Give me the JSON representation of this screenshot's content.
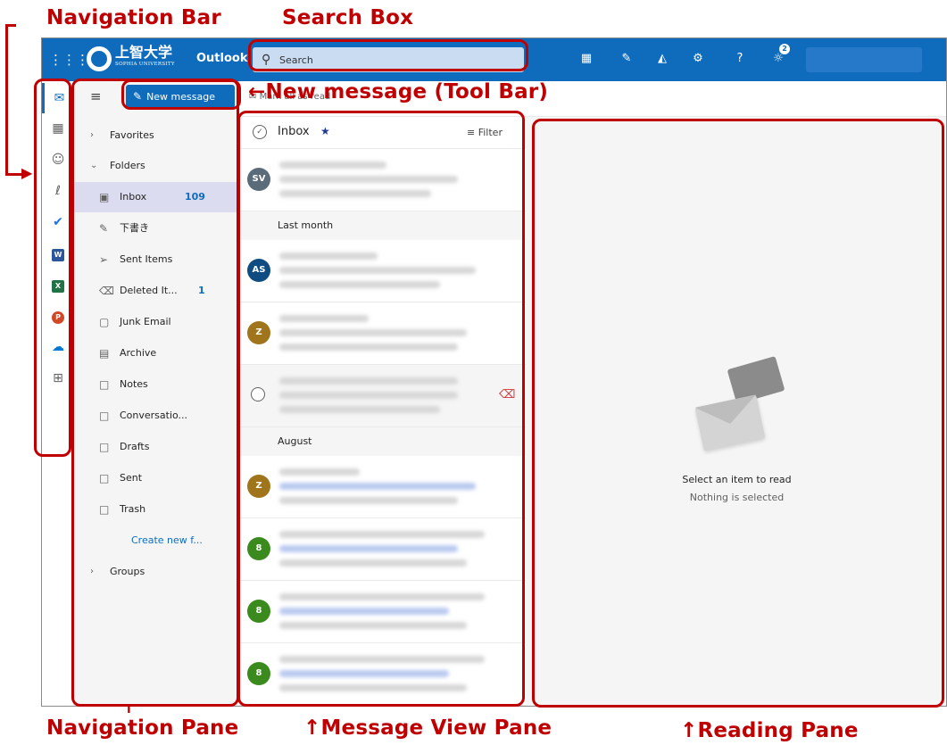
{
  "annotations": {
    "navigation_bar": "Navigation Bar",
    "search_box": "Search Box",
    "new_message_toolbar": "←New message (Tool Bar)",
    "navigation_pane": "Navigation Pane",
    "message_view_pane": "↑Message View Pane",
    "reading_pane": "↑Reading Pane",
    "up_arrow": "↑",
    "color": "#c00000"
  },
  "header": {
    "logo_jp": "上智大学",
    "logo_en": "SOPHIA UNIVERSITY",
    "app_name": "Outlook",
    "search_placeholder": "Search",
    "notification_badge": "2",
    "accent": "#0f6cbd",
    "icons": [
      "waffle-icon",
      "teams-icon",
      "feedback-icon",
      "bell-icon",
      "gear-icon",
      "help-icon",
      "lightbulb-icon"
    ]
  },
  "rail": {
    "items": [
      "mail-icon",
      "calendar-icon",
      "people-icon",
      "attachment-icon",
      "todo-icon",
      "word-icon",
      "excel-icon",
      "powerpoint-icon",
      "onedrive-icon",
      "more-apps-icon"
    ]
  },
  "nav": {
    "new_message": "New message",
    "favorites": "Favorites",
    "folders": "Folders",
    "items": [
      {
        "label": "Inbox",
        "count": "109"
      },
      {
        "label": "下書き",
        "count": ""
      },
      {
        "label": "Sent Items",
        "count": ""
      },
      {
        "label": "Deleted It...",
        "count": "1"
      },
      {
        "label": "Junk Email",
        "count": ""
      },
      {
        "label": "Archive",
        "count": ""
      },
      {
        "label": "Notes",
        "count": ""
      },
      {
        "label": "Conversatio...",
        "count": ""
      },
      {
        "label": "Drafts",
        "count": ""
      },
      {
        "label": "Sent",
        "count": ""
      },
      {
        "label": "Trash",
        "count": ""
      }
    ],
    "create_new_folder": "Create new f...",
    "groups": "Groups"
  },
  "cmdbar": {
    "mark_all_read": "Mark all as read"
  },
  "message_list": {
    "title": "Inbox",
    "filter": "Filter",
    "groups": [
      "Last month",
      "August"
    ],
    "avatars": [
      {
        "initials": "SV",
        "color": "#5a6b7a"
      },
      {
        "initials": "AS",
        "color": "#0f4c81"
      },
      {
        "initials": "Z",
        "color": "#a0741a"
      },
      {
        "initials": "Z",
        "color": "#a0741a"
      },
      {
        "initials": "8",
        "color": "#3a8a1e"
      },
      {
        "initials": "8",
        "color": "#3a8a1e"
      },
      {
        "initials": "8",
        "color": "#3a8a1e"
      }
    ]
  },
  "reading": {
    "title": "Select an item to read",
    "subtitle": "Nothing is selected"
  }
}
